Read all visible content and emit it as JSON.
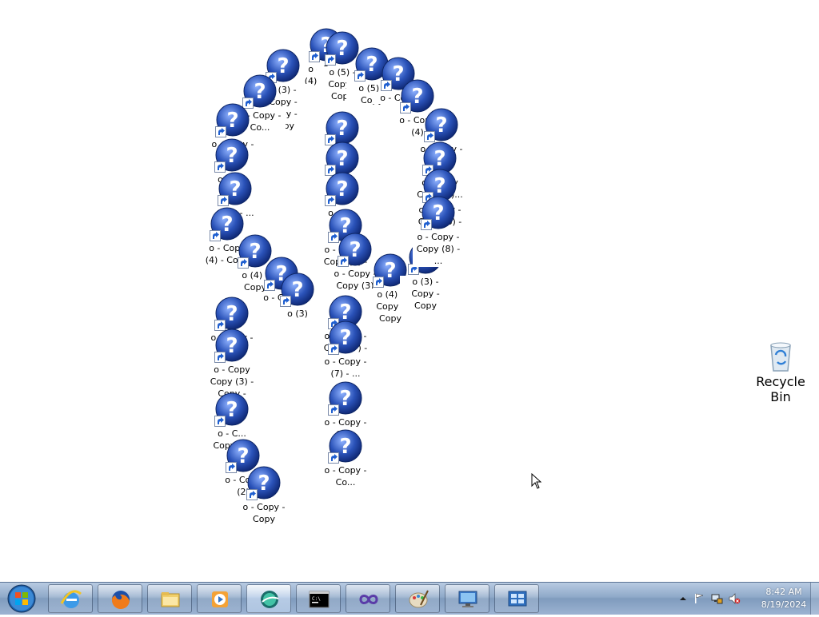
{
  "desktop": {
    "icons": [
      {
        "label": "o - Copy (4) - Copy"
      },
      {
        "label": "o (5) - Copy - Copy"
      },
      {
        "label": "o (5) - Copy"
      },
      {
        "label": "o - Copy"
      },
      {
        "label": "o - Copy (4)"
      },
      {
        "label": "o (3) - Copy - Copy - Copy"
      },
      {
        "label": "o - Copy - Co..."
      },
      {
        "label": "o - Copy - Co..."
      },
      {
        "label": "o - C..."
      },
      {
        "label": "o (3) - ..."
      },
      {
        "label": "o - Copy (4) - Copy"
      },
      {
        "label": "o (4) - Copy"
      },
      {
        "label": "o - Copy"
      },
      {
        "label": "o (3)"
      },
      {
        "label": "o (2)"
      },
      {
        "label": "o (2) - Copy"
      },
      {
        "label": "o - C..."
      },
      {
        "label": "o - Copy - Copy (5) - ..."
      },
      {
        "label": "o - Copy - Copy (3)"
      },
      {
        "label": "o (4) - Copy - Copy"
      },
      {
        "label": "o (3) - Copy - Copy"
      },
      {
        "label": "o - Copy - Co..."
      },
      {
        "label": "o - Copy Copy (3)..."
      },
      {
        "label": "o - Copy - Copy (6) - ..."
      },
      {
        "label": "o - Copy - Copy (8) - ..."
      },
      {
        "label": "o - Copy - Copy (7) - ..."
      },
      {
        "label": "o - Copy - (7) - ..."
      },
      {
        "label": "o - Copy - Co..."
      },
      {
        "label": "o - Copy - Co..."
      },
      {
        "label": "o - Copy - Copy"
      },
      {
        "label": "o - Copy Copy (3) - Copy - Copy"
      },
      {
        "label": "o - C... Copy (4)"
      },
      {
        "label": "o - Copy (2)"
      },
      {
        "label": "o - Copy - Copy"
      }
    ],
    "recycle_bin": {
      "label": "Recycle Bin"
    }
  },
  "taskbar": {
    "pinned": [
      {
        "name": "Internet Explorer"
      },
      {
        "name": "Firefox"
      },
      {
        "name": "Windows Explorer"
      },
      {
        "name": "Windows Media Player"
      },
      {
        "name": "Active App"
      },
      {
        "name": "Command Prompt"
      },
      {
        "name": "Visual Studio"
      },
      {
        "name": "Paint"
      },
      {
        "name": "Remote Desktop"
      },
      {
        "name": "Control Panel"
      }
    ],
    "clock": {
      "time": "8:42 AM",
      "date": "8/19/2024"
    }
  },
  "colors": {
    "taskbar": "#8fa9c9",
    "icon_blue": "#2a52b8"
  }
}
